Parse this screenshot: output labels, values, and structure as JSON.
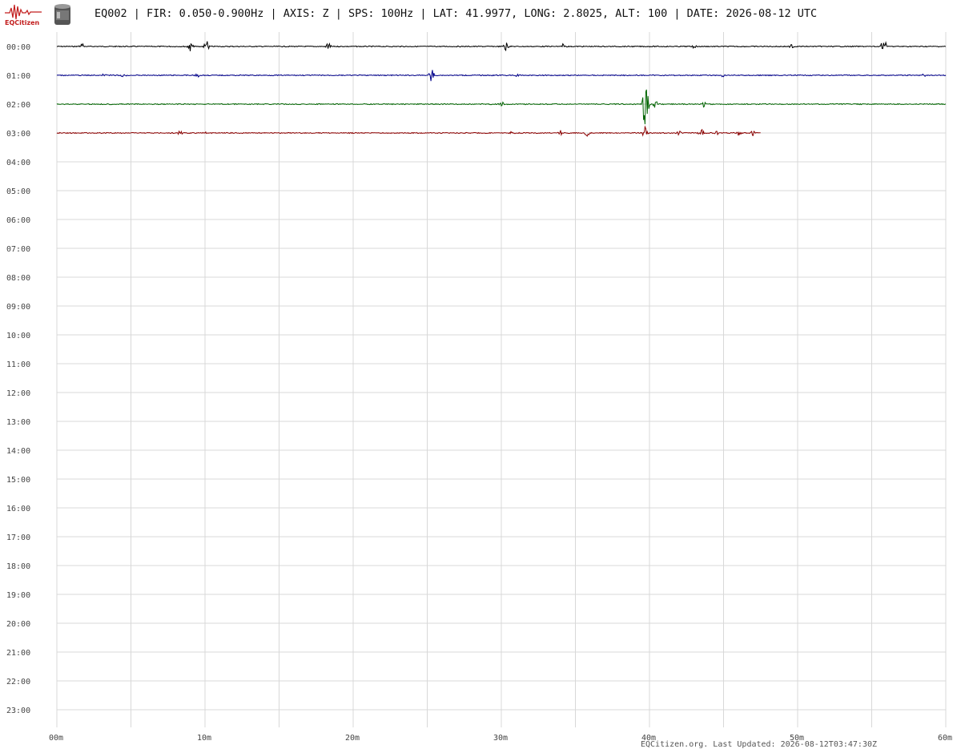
{
  "header": {
    "title": "EQ002 | FIR: 0.050-0.900Hz | AXIS: Z | SPS: 100Hz | LAT: 41.9977, LONG: 2.8025, ALT: 100 | DATE: 2026-08-12 UTC",
    "logo_text": "EQCitizen",
    "logo_icon": "seismogram-logo-icon",
    "device_icon": "sensor-cylinder-icon"
  },
  "footer": {
    "text": "EQCitizen.org. Last Updated: 2026-08-12T03:47:30Z"
  },
  "colors": {
    "grid": "#d8d8d8",
    "hour_colors": [
      "#000000",
      "#00008b",
      "#006400",
      "#8b0000"
    ]
  },
  "chart_data": {
    "type": "line",
    "title": "",
    "xlabel": "",
    "ylabel": "",
    "x_ticks": [
      "00m",
      "10m",
      "20m",
      "30m",
      "40m",
      "50m",
      "60m"
    ],
    "xlim": [
      0,
      60
    ],
    "y_ticks": [
      "00:00",
      "01:00",
      "02:00",
      "03:00",
      "04:00",
      "05:00",
      "06:00",
      "07:00",
      "08:00",
      "09:00",
      "10:00",
      "11:00",
      "12:00",
      "13:00",
      "14:00",
      "15:00",
      "16:00",
      "17:00",
      "18:00",
      "19:00",
      "20:00",
      "21:00",
      "22:00",
      "23:00"
    ],
    "grid": true,
    "series": [
      {
        "hour": "00:00",
        "start_min": 0,
        "end_min": 60,
        "spikes": [
          [
            1.7,
            0.12
          ],
          [
            9,
            0.16
          ],
          [
            10.1,
            0.22
          ],
          [
            18.3,
            0.14
          ],
          [
            30.3,
            0.2
          ],
          [
            34.2,
            0.1
          ],
          [
            43,
            0.08
          ],
          [
            49.6,
            0.1
          ],
          [
            55.7,
            0.12
          ],
          [
            55.9,
            0.18
          ]
        ]
      },
      {
        "hour": "01:00",
        "start_min": 0,
        "end_min": 60,
        "spikes": [
          [
            3.2,
            0.1
          ],
          [
            4.5,
            0.08
          ],
          [
            9.5,
            0.08
          ],
          [
            25.3,
            0.26
          ],
          [
            31,
            0.06
          ],
          [
            45,
            0.07
          ],
          [
            58.5,
            0.06
          ]
        ]
      },
      {
        "hour": "02:00",
        "start_min": 0,
        "end_min": 60,
        "spikes": [
          [
            30,
            0.1
          ],
          [
            39.7,
            1.0
          ],
          [
            39.8,
            0.55
          ],
          [
            40.4,
            0.14
          ],
          [
            43.7,
            0.12
          ]
        ]
      },
      {
        "hour": "03:00",
        "start_min": 0,
        "end_min": 47.5,
        "spikes": [
          [
            8.3,
            0.08
          ],
          [
            10,
            0.06
          ],
          [
            30.7,
            0.05
          ],
          [
            34,
            0.1
          ],
          [
            35.8,
            0.12
          ],
          [
            39.7,
            0.22
          ],
          [
            42,
            0.08
          ],
          [
            43.5,
            0.14
          ],
          [
            44.5,
            0.09
          ],
          [
            46,
            0.1
          ],
          [
            47,
            0.12
          ]
        ]
      }
    ]
  }
}
